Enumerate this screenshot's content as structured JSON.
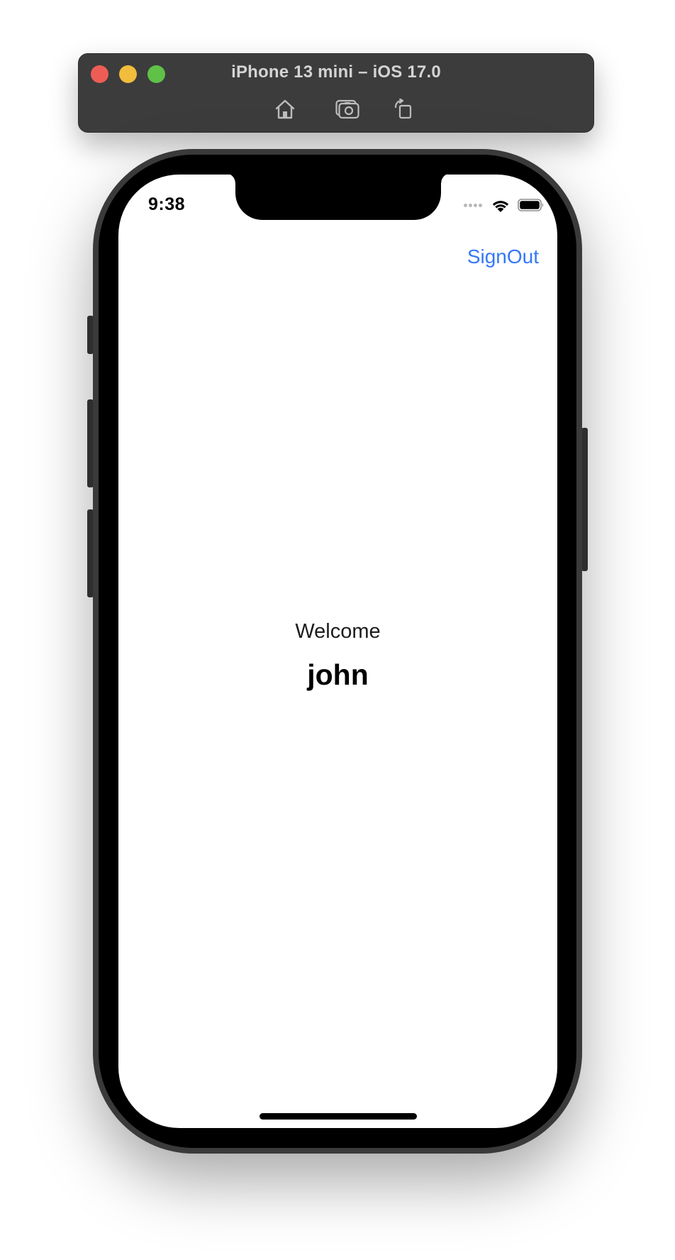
{
  "simulator": {
    "title": "iPhone 13 mini – iOS 17.0",
    "toolbar": {
      "home_icon": "home-icon",
      "screenshot_icon": "screenshot-icon",
      "rotate_icon": "rotate-icon"
    }
  },
  "status_bar": {
    "time": "9:38",
    "icons": [
      "cellular-signal-icon",
      "wifi-icon",
      "battery-icon"
    ]
  },
  "nav": {
    "signout_label": "SignOut"
  },
  "main": {
    "greeting": "Welcome",
    "username": "john"
  },
  "colors": {
    "accent": "#3478f6",
    "sim_bar": "#3c3c3c",
    "close": "#ee5d55",
    "minimize": "#f2bc3d",
    "zoom": "#5fc148"
  }
}
